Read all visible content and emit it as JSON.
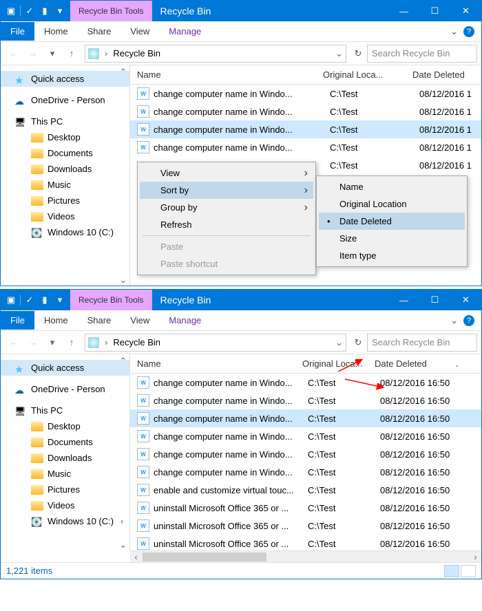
{
  "w1": {
    "contextual_tab": "Recycle Bin Tools",
    "title": "Recycle Bin",
    "ribbon": {
      "file": "File",
      "home": "Home",
      "share": "Share",
      "view": "View",
      "manage": "Manage"
    },
    "breadcrumb": "Recycle Bin",
    "search_placeholder": "Search Recycle Bin",
    "columns": {
      "name": "Name",
      "loc": "Original Loca...",
      "date": "Date Deleted"
    },
    "nav": {
      "quick": "Quick access",
      "onedrive": "OneDrive - Person",
      "pc": "This PC",
      "desktop": "Desktop",
      "documents": "Documents",
      "downloads": "Downloads",
      "music": "Music",
      "pictures": "Pictures",
      "videos": "Videos",
      "cdrive": "Windows 10 (C:)"
    },
    "rows": [
      {
        "name": "change computer name in Windo...",
        "loc": "C:\\Test",
        "date": "08/12/2016 1"
      },
      {
        "name": "change computer name in Windo...",
        "loc": "C:\\Test",
        "date": "08/12/2016 1"
      },
      {
        "name": "change computer name in Windo...",
        "loc": "C:\\Test",
        "date": "08/12/2016 1",
        "selected": true
      },
      {
        "name": "change computer name in Windo...",
        "loc": "C:\\Test",
        "date": "08/12/2016 1"
      },
      {
        "name": "",
        "loc": "C:\\Test",
        "date": "08/12/2016 1"
      }
    ],
    "context_menu": {
      "view": "View",
      "sortby": "Sort by",
      "groupby": "Group by",
      "refresh": "Refresh",
      "paste": "Paste",
      "paste_shortcut": "Paste shortcut"
    },
    "sort_submenu": {
      "name": "Name",
      "orig": "Original Location",
      "date": "Date Deleted",
      "size": "Size",
      "itemtype": "Item type"
    }
  },
  "w2": {
    "contextual_tab": "Recycle Bin Tools",
    "title": "Recycle Bin",
    "ribbon": {
      "file": "File",
      "home": "Home",
      "share": "Share",
      "view": "View",
      "manage": "Manage"
    },
    "breadcrumb": "Recycle Bin",
    "search_placeholder": "Search Recycle Bin",
    "columns": {
      "name": "Name",
      "loc": "Original Loca...",
      "date": "Date Deleted"
    },
    "nav": {
      "quick": "Quick access",
      "onedrive": "OneDrive - Person",
      "pc": "This PC",
      "desktop": "Desktop",
      "documents": "Documents",
      "downloads": "Downloads",
      "music": "Music",
      "pictures": "Pictures",
      "videos": "Videos",
      "cdrive": "Windows 10 (C:)"
    },
    "rows": [
      {
        "name": "change computer name in Windo...",
        "loc": "C:\\Test",
        "date": "08/12/2016 16:50"
      },
      {
        "name": "change computer name in Windo...",
        "loc": "C:\\Test",
        "date": "08/12/2016 16:50"
      },
      {
        "name": "change computer name in Windo...",
        "loc": "C:\\Test",
        "date": "08/12/2016 16:50",
        "selected": true
      },
      {
        "name": "change computer name in Windo...",
        "loc": "C:\\Test",
        "date": "08/12/2016 16:50"
      },
      {
        "name": "change computer name in Windo...",
        "loc": "C:\\Test",
        "date": "08/12/2016 16:50"
      },
      {
        "name": "change computer name in Windo...",
        "loc": "C:\\Test",
        "date": "08/12/2016 16:50"
      },
      {
        "name": "enable and customize virtual touc...",
        "loc": "C:\\Test",
        "date": "08/12/2016 16:50"
      },
      {
        "name": "uninstall Microsoft Office 365 or ...",
        "loc": "C:\\Test",
        "date": "08/12/2016 16:50"
      },
      {
        "name": "uninstall Microsoft Office 365 or ...",
        "loc": "C:\\Test",
        "date": "08/12/2016 16:50"
      },
      {
        "name": "uninstall Microsoft Office 365 or ...",
        "loc": "C:\\Test",
        "date": "08/12/2016 16:50"
      }
    ],
    "status": "1,221 items"
  }
}
